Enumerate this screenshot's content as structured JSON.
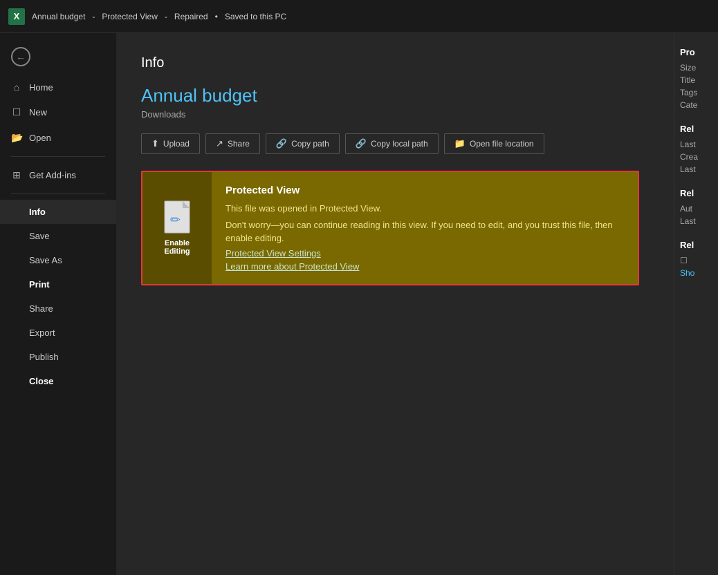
{
  "titlebar": {
    "app_name": "X",
    "file_title": "Annual budget",
    "separator1": "-",
    "protected_view": "Protected View",
    "separator2": "-",
    "repaired": "Repaired",
    "bullet": "•",
    "save_status": "Saved to this PC"
  },
  "sidebar": {
    "back_label": "←",
    "items": [
      {
        "id": "home",
        "label": "Home",
        "icon": "⌂",
        "active": false,
        "bold": false
      },
      {
        "id": "new",
        "label": "New",
        "icon": "☐",
        "active": false,
        "bold": false
      },
      {
        "id": "open",
        "label": "Open",
        "icon": "📂",
        "active": false,
        "bold": false
      },
      {
        "id": "get-add-ins",
        "label": "Get Add-ins",
        "icon": "⊞",
        "active": false,
        "bold": false
      },
      {
        "id": "info",
        "label": "Info",
        "icon": "",
        "active": true,
        "bold": false
      },
      {
        "id": "save",
        "label": "Save",
        "icon": "",
        "active": false,
        "bold": false
      },
      {
        "id": "save-as",
        "label": "Save As",
        "icon": "",
        "active": false,
        "bold": false
      },
      {
        "id": "print",
        "label": "Print",
        "icon": "",
        "active": false,
        "bold": true
      },
      {
        "id": "share",
        "label": "Share",
        "icon": "",
        "active": false,
        "bold": false
      },
      {
        "id": "export",
        "label": "Export",
        "icon": "",
        "active": false,
        "bold": false
      },
      {
        "id": "publish",
        "label": "Publish",
        "icon": "",
        "active": false,
        "bold": false
      },
      {
        "id": "close",
        "label": "Close",
        "icon": "",
        "active": false,
        "bold": true
      }
    ]
  },
  "main": {
    "page_title": "Info",
    "file_name": "Annual budget",
    "file_location": "Downloads",
    "buttons": [
      {
        "id": "upload",
        "label": "Upload",
        "icon": "⬆"
      },
      {
        "id": "share",
        "label": "Share",
        "icon": "↗"
      },
      {
        "id": "copy-path",
        "label": "Copy path",
        "icon": "🔗"
      },
      {
        "id": "copy-local-path",
        "label": "Copy local path",
        "icon": "🔗"
      },
      {
        "id": "open-file-location",
        "label": "Open file location",
        "icon": "📁"
      }
    ],
    "banner": {
      "icon_label": "Enable\nEditing",
      "title": "Protected View",
      "line1": "This file was opened in Protected View.",
      "line2": "Don't worry—you can continue reading in this view. If you need to edit, and you trust this file, then enable editing.",
      "link1": "Protected View Settings",
      "link2": "Learn more about Protected View"
    }
  },
  "right_panel": {
    "properties_heading": "Pro",
    "size_label": "Size",
    "title_label": "Title",
    "tags_label": "Tags",
    "categories_label": "Cate",
    "related_heading": "Rel",
    "last_modified_label": "Last",
    "created_label": "Crea",
    "last_printed_label": "Last",
    "related_people_heading": "Rel",
    "author_label": "Aut",
    "last_modified_by_label": "Last",
    "related_docs_heading": "Rel",
    "show_all_label": "Sho"
  },
  "colors": {
    "excel_green": "#217346",
    "file_name_blue": "#4fc3f7",
    "banner_bg": "#7a6800",
    "banner_border": "#e53935",
    "banner_icon_bg": "#5a4d00",
    "link_color": "#c8e6c9"
  }
}
